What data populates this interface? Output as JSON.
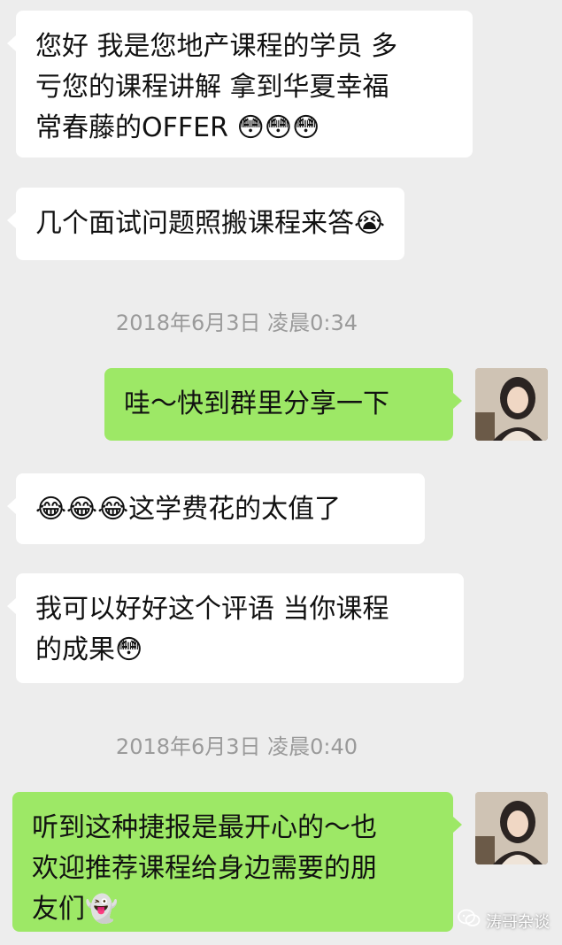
{
  "messages": [
    {
      "text": "您好 我是您地产课程的学员 多\n亏您的课程讲解 拿到华夏幸福\n常春藤的OFFER 😳😳😳"
    },
    {
      "text": "几个面试问题照搬课程来答😭"
    },
    {
      "text": "哇～快到群里分享一下"
    },
    {
      "text": "😂😂😂这学费花的太值了"
    },
    {
      "text": "我可以好好这个评语 当你课程\n的成果😳"
    },
    {
      "text": "听到这种捷报是最开心的～也\n欢迎推荐课程给身边需要的朋\n友们👻"
    }
  ],
  "timestamps": [
    "2018年6月3日 凌晨0:34",
    "2018年6月3日 凌晨0:40"
  ],
  "watermark": {
    "text": "涛哥杂谈",
    "icon": "wechat-icon"
  },
  "colors": {
    "background": "#ededed",
    "incoming": "#ffffff",
    "outgoing": "#9de866",
    "timestamp": "#9a9a9a"
  }
}
